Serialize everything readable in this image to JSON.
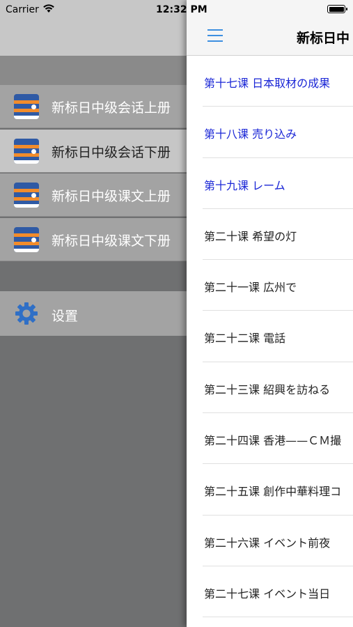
{
  "status_bar": {
    "carrier": "Carrier",
    "time": "12:32 PM"
  },
  "drawer": {
    "books": [
      {
        "label": "新标日中级会话上册",
        "selected": false
      },
      {
        "label": "新标日中级会话下册",
        "selected": true
      },
      {
        "label": "新标日中级课文上册",
        "selected": false
      },
      {
        "label": "新标日中级课文下册",
        "selected": false
      }
    ],
    "settings_label": "设置"
  },
  "main": {
    "title": "新标日中",
    "lessons": [
      {
        "title": "第十七课 日本取材の成果",
        "highlight": true
      },
      {
        "title": "第十八课 売り込み",
        "highlight": true
      },
      {
        "title": "第十九课 レーム",
        "highlight": true
      },
      {
        "title": "第二十课 希望の灯",
        "highlight": false
      },
      {
        "title": "第二十一课 広州で",
        "highlight": false
      },
      {
        "title": "第二十二课 電話",
        "highlight": false
      },
      {
        "title": "第二十三课 紹興を訪ねる",
        "highlight": false
      },
      {
        "title": "第二十四课 香港——ＣＭ撮",
        "highlight": false
      },
      {
        "title": "第二十五课 創作中華料理コ",
        "highlight": false
      },
      {
        "title": "第二十六课 イベント前夜",
        "highlight": false
      },
      {
        "title": "第二十七课 イベント当日",
        "highlight": false
      }
    ]
  },
  "colors": {
    "accent": "#3d8fe0",
    "link_text": "#1a26d6",
    "drawer_bg": "#6f7071"
  }
}
